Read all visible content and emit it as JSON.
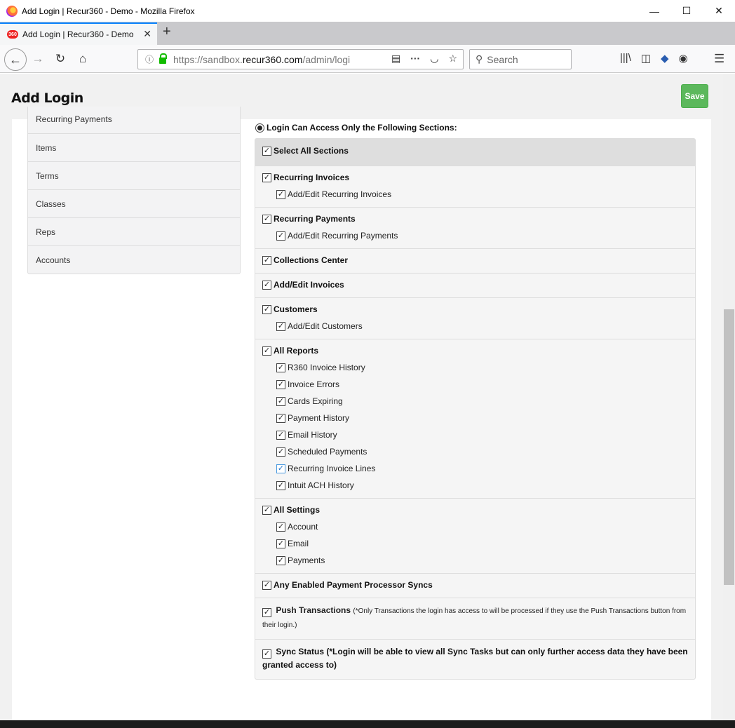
{
  "window": {
    "title": "Add Login | Recur360 - Demo - Mozilla Firefox",
    "minimize": "—",
    "maximize": "☐",
    "close": "✕"
  },
  "tab": {
    "label": "Add Login | Recur360 - Demo",
    "favicon": "360",
    "close": "✕",
    "new_tab": "+"
  },
  "nav": {
    "url_prefix": "https://sandbox.",
    "url_domain": "recur360.com",
    "url_path": "/admin/logi",
    "search_placeholder": "Search",
    "icons": [
      "back-icon",
      "forward-icon",
      "reload-icon",
      "home-icon",
      "info-icon",
      "lock-icon",
      "reader-view-icon",
      "page-actions-icon",
      "pocket-icon",
      "bookmark-star-icon",
      "search-icon",
      "library-icon",
      "sidebar-icon",
      "tracking-icon",
      "account-icon",
      "menu-icon"
    ]
  },
  "page": {
    "title": "Add Login",
    "save_label": "Save",
    "accent_color": "#5cb85c"
  },
  "sidebar": {
    "items": [
      {
        "label": "Recurring Payments"
      },
      {
        "label": "Items"
      },
      {
        "label": "Terms"
      },
      {
        "label": "Classes"
      },
      {
        "label": "Reps"
      },
      {
        "label": "Accounts"
      }
    ]
  },
  "access": {
    "radio_label": "Login Can Access Only the Following Sections:",
    "select_all": "Select All Sections",
    "sections": [
      {
        "label": "Recurring Invoices",
        "subs": [
          "Add/Edit Recurring Invoices"
        ]
      },
      {
        "label": "Recurring Payments",
        "subs": [
          "Add/Edit Recurring Payments"
        ]
      },
      {
        "label": "Collections Center",
        "subs": []
      },
      {
        "label": "Add/Edit Invoices",
        "subs": []
      },
      {
        "label": "Customers",
        "subs": [
          "Add/Edit Customers"
        ]
      },
      {
        "label": "All Reports",
        "subs": [
          "R360 Invoice History",
          "Invoice Errors",
          "Cards Expiring",
          "Payment History",
          "Email History",
          "Scheduled Payments",
          "Recurring Invoice Lines",
          "Intuit ACH History"
        ]
      },
      {
        "label": "All Settings",
        "subs": [
          "Account",
          "Email",
          "Payments"
        ]
      },
      {
        "label": "Any Enabled Payment Processor Syncs",
        "subs": []
      }
    ],
    "push": {
      "label": "Push Transactions",
      "note": "(*Only Transactions the login has access to will be processed if they use the Push Transactions button from their login.)"
    },
    "sync": {
      "label": "Sync Status (*Login will be able to view all Sync Tasks but can only further access data they have been granted access to)"
    }
  }
}
